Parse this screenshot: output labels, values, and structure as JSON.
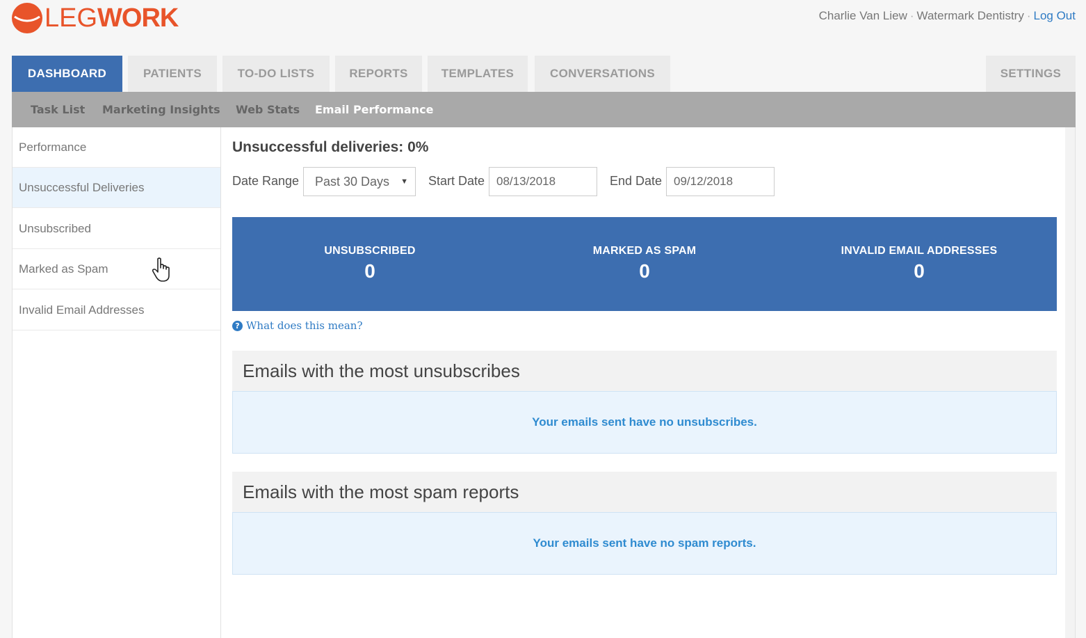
{
  "header": {
    "logo_text_light": "LEG",
    "logo_text_bold": "WORK",
    "user_name": "Charlie Van Liew",
    "practice": "Watermark Dentistry",
    "logout": "Log Out"
  },
  "tabs": [
    {
      "label": "DASHBOARD",
      "active": true
    },
    {
      "label": "PATIENTS"
    },
    {
      "label": "TO-DO LISTS"
    },
    {
      "label": "REPORTS"
    },
    {
      "label": "TEMPLATES"
    },
    {
      "label": "CONVERSATIONS"
    },
    {
      "label": "SETTINGS"
    }
  ],
  "subnav": [
    {
      "label": "Task List"
    },
    {
      "label": "Marketing Insights"
    },
    {
      "label": "Web Stats"
    },
    {
      "label": "Email Performance",
      "active": true
    }
  ],
  "sidebar": [
    {
      "label": "Performance"
    },
    {
      "label": "Unsuccessful Deliveries",
      "active": true
    },
    {
      "label": "Unsubscribed"
    },
    {
      "label": "Marked as Spam"
    },
    {
      "label": "Invalid Email Addresses"
    }
  ],
  "main": {
    "title": "Unsuccessful deliveries: 0%",
    "filters": {
      "date_range_label": "Date Range",
      "date_range_value": "Past 30 Days",
      "start_date_label": "Start Date",
      "start_date_value": "08/13/2018",
      "end_date_label": "End Date",
      "end_date_value": "09/12/2018"
    },
    "stats": [
      {
        "label": "UNSUBSCRIBED",
        "value": "0"
      },
      {
        "label": "MARKED AS SPAM",
        "value": "0"
      },
      {
        "label": "INVALID EMAIL ADDRESSES",
        "value": "0"
      }
    ],
    "help_text": "What does this mean?",
    "sections": [
      {
        "title": "Emails with the most unsubscribes",
        "message": "Your emails sent have no unsubscribes."
      },
      {
        "title": "Emails with the most spam reports",
        "message": "Your emails sent have no spam reports."
      }
    ]
  },
  "colors": {
    "brand_orange": "#e8542a",
    "primary_blue": "#3d6eb0",
    "link_blue": "#2f7bc4",
    "info_bg": "#eaf4fd"
  },
  "icons": [
    "logo-circle-icon",
    "dropdown-arrow-icon",
    "help-question-icon",
    "hand-pointer-cursor-icon"
  ]
}
